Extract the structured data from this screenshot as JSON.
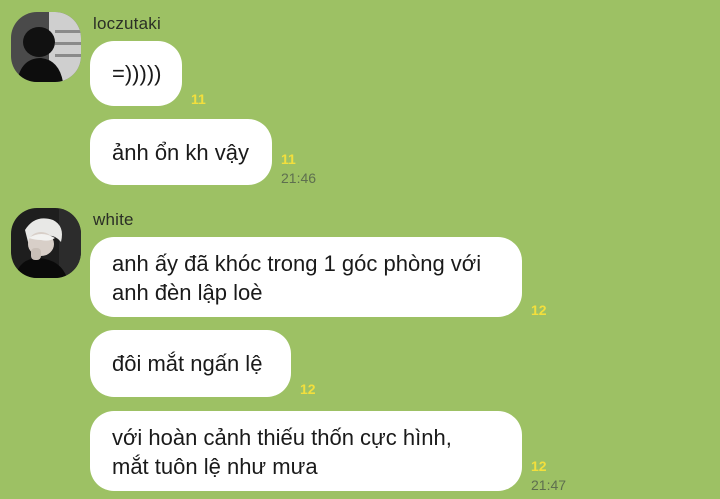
{
  "messages_group_1": {
    "sender": "loczutaki",
    "avatar_icon": "user-avatar-dark",
    "messages": [
      {
        "text": "=)))))",
        "read_count": "11"
      },
      {
        "text": "ảnh ổn kh vậy",
        "read_count": "11",
        "time": "21:46"
      }
    ]
  },
  "messages_group_2": {
    "sender": "white",
    "avatar_icon": "user-avatar-white-hair",
    "messages": [
      {
        "lines": [
          "anh ấy đã khóc trong 1 góc phòng với",
          "anh đèn lập loè"
        ],
        "read_count": "12"
      },
      {
        "text": "đôi mắt ngấn lệ",
        "read_count": "12"
      },
      {
        "lines": [
          "với hoàn cảnh thiếu thốn cực hình,",
          "mắt tuôn lệ như mưa"
        ],
        "read_count": "12",
        "time": "21:47"
      }
    ]
  },
  "colors": {
    "background": "#9dc164",
    "bubble": "#ffffff",
    "read_count": "#f3df3c",
    "timestamp": "#5e6f4f"
  }
}
